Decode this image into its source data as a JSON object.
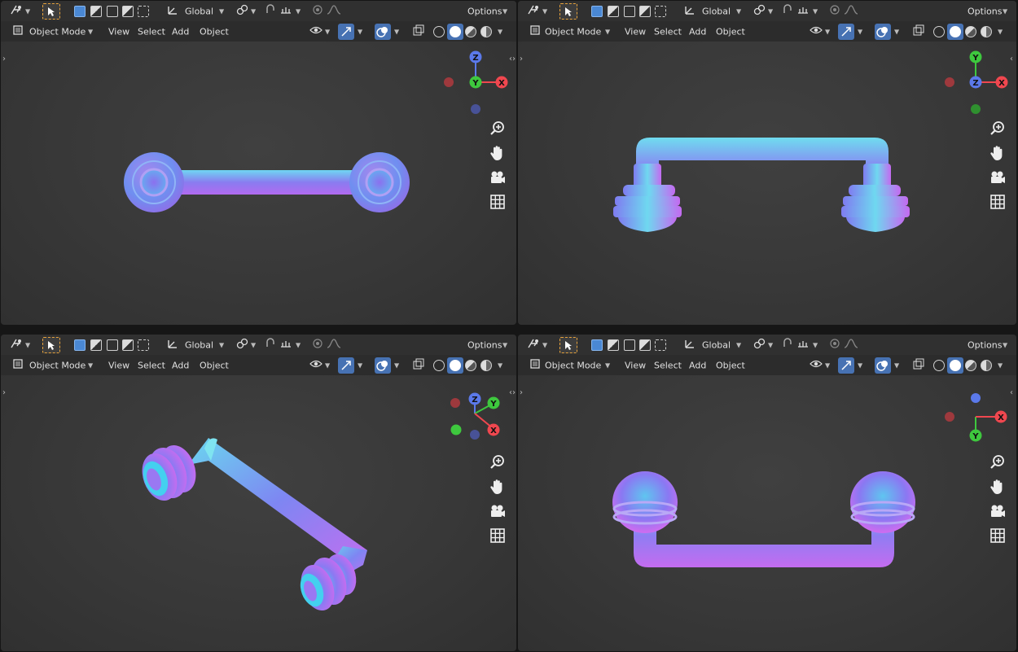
{
  "viewports": [
    {
      "id": "top-left",
      "header": {
        "transform_orientation": "Global",
        "options_label": "Options"
      },
      "menu": {
        "mode": "Object Mode",
        "view": "View",
        "select": "Select",
        "add": "Add",
        "object": "Object"
      },
      "gizmo": {
        "axes": [
          "Z",
          "Y",
          "X"
        ]
      },
      "nav_icons": [
        "zoom-icon",
        "hand-icon",
        "camera-icon",
        "grid-icon"
      ]
    },
    {
      "id": "top-right",
      "header": {
        "transform_orientation": "Global",
        "options_label": "Options"
      },
      "menu": {
        "mode": "Object Mode",
        "view": "View",
        "select": "Select",
        "add": "Add",
        "object": "Object"
      },
      "gizmo": {
        "axes": [
          "Y",
          "Z",
          "X"
        ]
      },
      "nav_icons": [
        "zoom-icon",
        "hand-icon",
        "camera-icon",
        "grid-icon"
      ]
    },
    {
      "id": "bottom-left",
      "header": {
        "transform_orientation": "Global",
        "options_label": "Options"
      },
      "menu": {
        "mode": "Object Mode",
        "view": "View",
        "select": "Select",
        "add": "Add",
        "object": "Object"
      },
      "gizmo": {
        "axes": [
          "Z",
          "Y",
          "X"
        ]
      },
      "nav_icons": [
        "zoom-icon",
        "hand-icon",
        "camera-icon",
        "grid-icon"
      ]
    },
    {
      "id": "bottom-right",
      "header": {
        "transform_orientation": "Global",
        "options_label": "Options"
      },
      "menu": {
        "mode": "Object Mode",
        "view": "View",
        "select": "Select",
        "add": "Add",
        "object": "Object"
      },
      "gizmo": {
        "axes": [
          "X",
          "Y"
        ]
      },
      "nav_icons": [
        "zoom-icon",
        "hand-icon",
        "camera-icon",
        "grid-icon"
      ]
    }
  ],
  "colors": {
    "axis_x": "#f0474f",
    "axis_y": "#3ec83e",
    "axis_z": "#5b79ea",
    "active_blue": "#4772b3",
    "tool_outline": "#e6a23c"
  }
}
